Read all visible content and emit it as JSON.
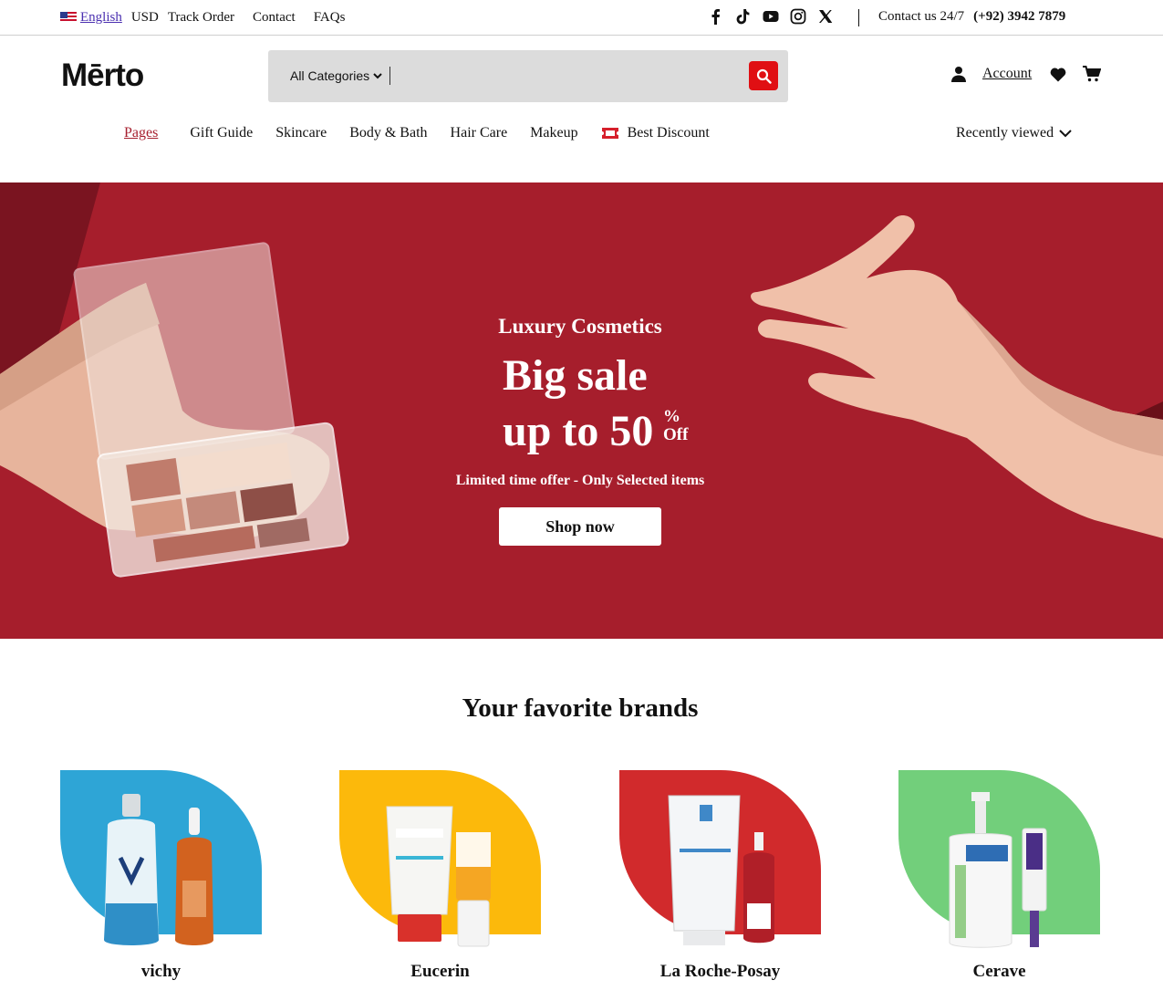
{
  "topbar": {
    "language": "English",
    "currency": "USD",
    "links": [
      "Track Order",
      "Contact",
      "FAQs"
    ],
    "contact_label": "Contact us 24/7",
    "phone": "(+92) 3942 7879"
  },
  "header": {
    "logo": "Mērto",
    "search": {
      "category": "All Categories",
      "placeholder": ""
    },
    "account_label": "Account"
  },
  "nav": {
    "items": [
      "Pages",
      "Gift Guide",
      "Skincare",
      "Body & Bath",
      "Hair Care",
      "Makeup"
    ],
    "discount": "Best Discount",
    "recently_viewed": "Recently viewed"
  },
  "hero": {
    "subtitle": "Luxury Cosmetics",
    "line1": "Big sale",
    "line2": "up to 50",
    "percent": "%",
    "off": "Off",
    "note": "Limited time offer - Only Selected items",
    "cta": "Shop now"
  },
  "brands": {
    "title": "Your favorite brands",
    "items": [
      {
        "name": "vichy",
        "color": "#2ea5d6"
      },
      {
        "name": "Eucerin",
        "color": "#fcb90b"
      },
      {
        "name": "La Roche-Posay",
        "color": "#d12a2c"
      },
      {
        "name": "Cerave",
        "color": "#72cf7b"
      }
    ]
  },
  "colors": {
    "accent": "#e00f13",
    "hero_bg": "#a61e2c",
    "nav_active": "#a61f2e"
  },
  "icons": [
    "flag-us-icon",
    "facebook-icon",
    "tiktok-icon",
    "youtube-icon",
    "instagram-icon",
    "x-icon",
    "search-icon",
    "user-icon",
    "heart-icon",
    "cart-icon",
    "ticket-icon",
    "chevron-down-icon"
  ]
}
